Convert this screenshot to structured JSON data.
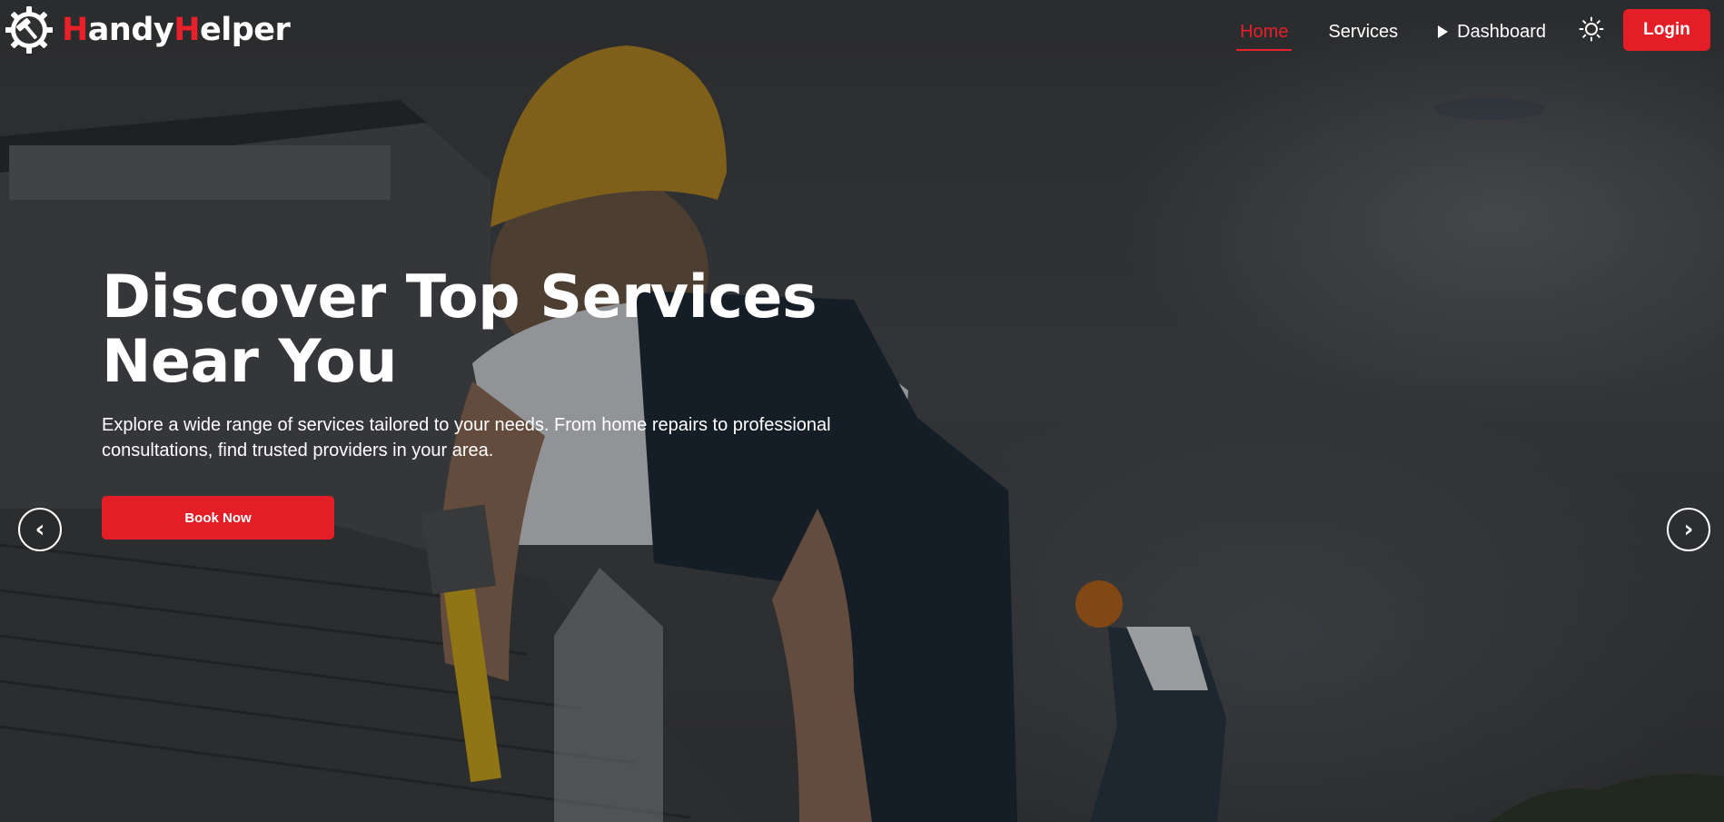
{
  "brand": {
    "name_initial_1": "H",
    "name_rest_1": "andy",
    "name_initial_2": "H",
    "name_rest_2": "elper",
    "logo_icon": "gear-hammer-icon",
    "accent_color": "#e8202a"
  },
  "nav": {
    "items": [
      {
        "label": "Home",
        "active": true
      },
      {
        "label": "Services",
        "active": false
      },
      {
        "label": "Dashboard",
        "active": false,
        "icon": "play-icon"
      }
    ],
    "theme_toggle_icon": "sun-icon",
    "login_label": "Login",
    "login_color": "#e41e26"
  },
  "hero": {
    "title_line_1": "Discover Top Services",
    "title_line_2": "Near You",
    "subtitle": "Explore a wide range of services tailored to your needs. From home repairs to professional consultations, find trusted providers in your area.",
    "cta_label": "Book Now",
    "background_description_icon": "worker-roof-photo",
    "prev_arrow": "‹",
    "next_arrow": "›"
  }
}
